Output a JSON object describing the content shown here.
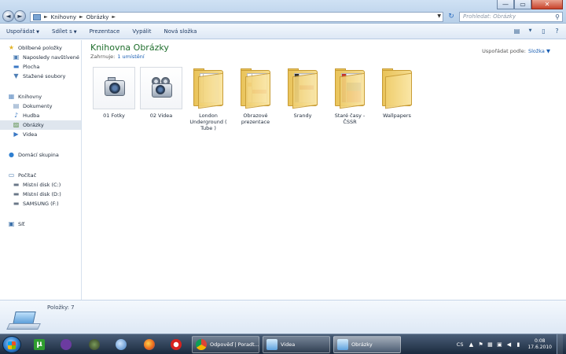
{
  "window": {
    "minimize_glyph": "—",
    "maximize_glyph": "▭",
    "close_glyph": "✕"
  },
  "address": {
    "crumbs": [
      "Knihovny",
      "Obrázky"
    ],
    "search_placeholder": "Prohledat: Obrázky"
  },
  "toolbar": {
    "organize": "Uspořádat",
    "share": "Sdílet s",
    "slideshow": "Prezentace",
    "burn": "Vypálit",
    "new_folder": "Nová složka"
  },
  "sidebar": {
    "favorites": {
      "label": "Oblíbené položky",
      "items": [
        "Naposledy navštívené",
        "Plocha",
        "Stažené soubory"
      ]
    },
    "libraries": {
      "label": "Knihovny",
      "items": [
        "Dokumenty",
        "Hudba",
        "Obrázky",
        "Videa"
      ]
    },
    "homegroup": "Domácí skupina",
    "computer": {
      "label": "Počítač",
      "items": [
        "Místní disk (C:)",
        "Místní disk (D:)",
        "SAMSUNG (F:)"
      ]
    },
    "network": "Síť"
  },
  "main": {
    "library_title": "Knihovna Obrázky",
    "includes_label": "Zahrnuje:",
    "includes_link": "1 umístění",
    "arrange_label": "Uspořádat podle:",
    "arrange_value": "Složka",
    "items": [
      {
        "label": "01 Fotky",
        "kind": "camera-icon"
      },
      {
        "label": "02 Videa",
        "kind": "video-camera-icon"
      },
      {
        "label": "London Underground ( Tube )",
        "kind": "folder-icon"
      },
      {
        "label": "Obrazové prezentace",
        "kind": "folder-icon"
      },
      {
        "label": "Srandy",
        "kind": "folder-icon"
      },
      {
        "label": "Staré časy - ČSSR",
        "kind": "folder-icon"
      },
      {
        "label": "Wallpapers",
        "kind": "folder-icon"
      }
    ]
  },
  "details": {
    "count": "Položky: 7"
  },
  "taskbar": {
    "tasks": [
      "Odpověď | Poradt...",
      "Videa",
      "Obrázky"
    ],
    "language": "CS",
    "time": "0:08",
    "date": "17.6.2010"
  },
  "colors": {
    "library_title": "#1f6e2c",
    "link": "#1a5fb4",
    "folder": "#e9c35a"
  }
}
